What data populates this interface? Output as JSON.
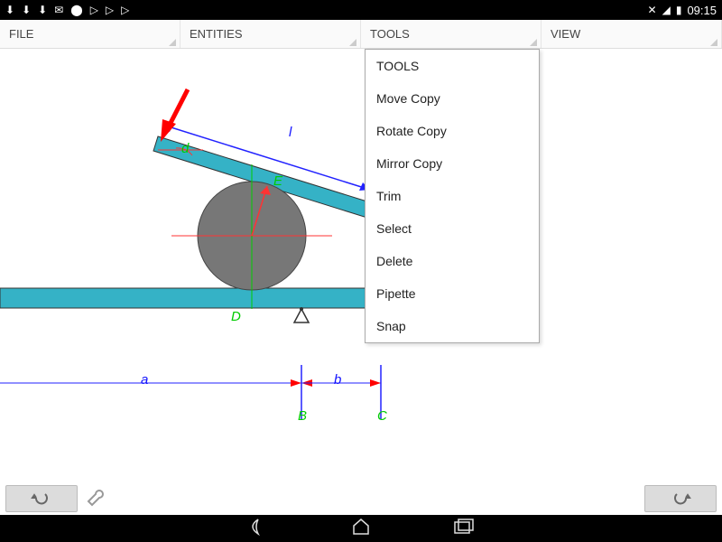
{
  "status": {
    "icons": [
      "download",
      "download",
      "download",
      "mail",
      "warning",
      "triangle",
      "play",
      "play"
    ],
    "right_icons": [
      "vibrate",
      "wifi",
      "battery"
    ],
    "time": "09:15"
  },
  "menu": {
    "items": [
      "FILE",
      "ENTITIES",
      "TOOLS",
      "VIEW"
    ]
  },
  "tools_dropdown": {
    "header": "TOOLS",
    "items": [
      "Move Copy",
      "Rotate Copy",
      "Mirror Copy",
      "Trim",
      "Select",
      "Delete",
      "Pipette",
      "Snap"
    ]
  },
  "drawing": {
    "labels": {
      "l": "l",
      "d": "d",
      "E": "E",
      "D": "D",
      "a": "a",
      "b": "b",
      "B": "B",
      "C": "C"
    }
  }
}
